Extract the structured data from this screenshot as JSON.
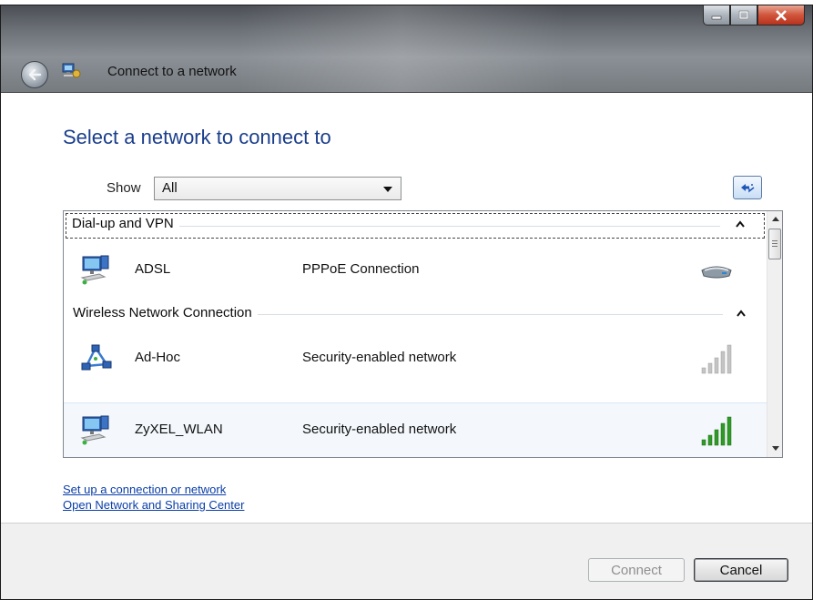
{
  "window": {
    "title": "Connect to a network",
    "controls": [
      "minimize",
      "maximize",
      "close"
    ]
  },
  "heading": "Select a network to connect to",
  "filter": {
    "label": "Show",
    "selected": "All"
  },
  "groups": [
    {
      "name": "Dial-up and VPN",
      "items": [
        {
          "name": "ADSL",
          "description": "PPPoE Connection",
          "icon": "network-computer-icon",
          "status_icon": "modem-icon"
        }
      ]
    },
    {
      "name": "Wireless Network Connection",
      "items": [
        {
          "name": "Ad-Hoc",
          "description": "Security-enabled network",
          "icon": "adhoc-network-icon",
          "status_icon": "signal-strength-icon",
          "signal_bars": 0
        },
        {
          "name": "ZyXEL_WLAN",
          "description": "Security-enabled network",
          "icon": "network-computer-icon",
          "status_icon": "signal-strength-icon",
          "signal_bars": 5
        }
      ]
    }
  ],
  "links": {
    "setup": "Set up a connection or network",
    "sharing_center": "Open Network and Sharing Center"
  },
  "buttons": {
    "connect": "Connect",
    "cancel": "Cancel"
  },
  "colors": {
    "heading": "#1a3e8c",
    "link": "#0a3ea8",
    "signal_active": "#2f9b27",
    "signal_inactive": "#b9b9b9",
    "close_button": "#c9432a"
  }
}
